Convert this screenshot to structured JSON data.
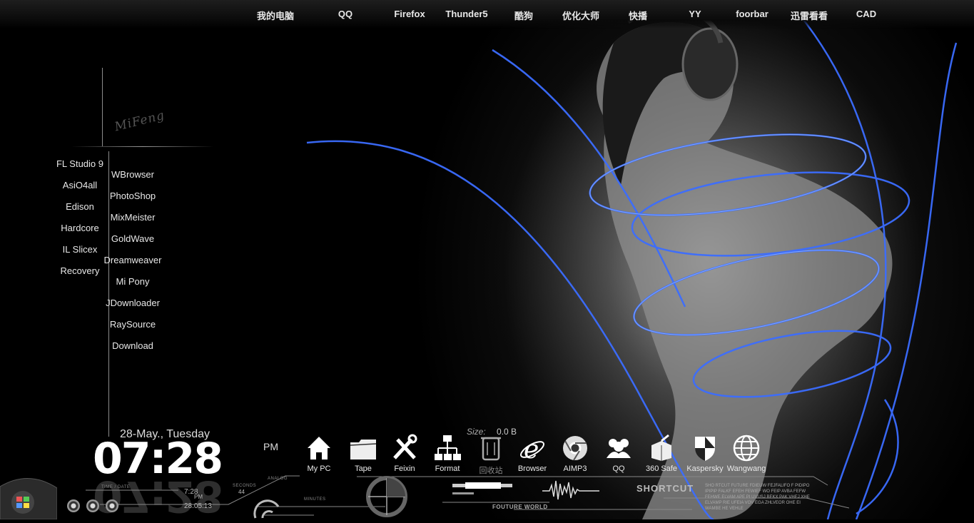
{
  "topbar": {
    "items": [
      "我的电脑",
      "QQ",
      "Firefox",
      "Thunder5",
      "酷狗",
      "优化大师",
      "快播",
      "YY",
      "foorbar",
      "迅雷看看",
      "CAD"
    ]
  },
  "sidebar": {
    "brand": "MiFeng",
    "col1": [
      "FL Studio 9",
      "AsiO4all",
      "Edison",
      "Hardcore",
      "IL Slicex",
      "Recovery"
    ],
    "col2": [
      "WBrowser",
      "PhotoShop",
      "MixMeister",
      "GoldWave",
      "Dreamweaver",
      "Mi Pony",
      "JDownloader",
      "RaySource",
      "Download"
    ]
  },
  "clock": {
    "date": "28-May., Tuesday",
    "time": "07:28",
    "ampm": "PM",
    "small_time": "7:28",
    "small_ampm": "PM",
    "small_date": "28.05.13",
    "seconds_value": "44",
    "label_time_date": "TIME / DATE",
    "label_seconds": "SECONDS",
    "label_analog": "ANALOG",
    "label_minutes": "MINUTES"
  },
  "recycle": {
    "size_label": "Size:",
    "size_value": "0.0 B"
  },
  "dock": {
    "items": [
      {
        "label": "My PC",
        "icon": "house-icon"
      },
      {
        "label": "Tape",
        "icon": "folder-icon"
      },
      {
        "label": "Feixin",
        "icon": "tools-icon"
      },
      {
        "label": "Format",
        "icon": "network-icon"
      },
      {
        "label": "回收站",
        "icon": "trash-icon"
      },
      {
        "label": "Browser",
        "icon": "ie-icon"
      },
      {
        "label": "AIMP3",
        "icon": "chrome-icon"
      },
      {
        "label": "QQ",
        "icon": "users-icon"
      },
      {
        "label": "360 Safe",
        "icon": "box-icon"
      },
      {
        "label": "Kaspersky",
        "icon": "shield-icon"
      },
      {
        "label": "Wangwang",
        "icon": "globe-icon"
      }
    ]
  },
  "shortcut": {
    "title": "SHORTCUT",
    "future_world": "FOUTURE WORLD",
    "blurb": "SHO RTCUT FUTURE FDIEUW FEJFALIFO F PIDIPO IPIPIP FALKF EFEH FEWIEF WO FEIP AVBA FEFW FEHWE ELVAM APE PI UVUSJ BEKX PAK VHEJ XHE ELVAMP RIE UFEIA VOV EGA ZHLVEOR OHE EI WAMBE HE VEHLE"
  },
  "colors": {
    "accent_blue": "#3b6dff",
    "bg": "#000000"
  }
}
